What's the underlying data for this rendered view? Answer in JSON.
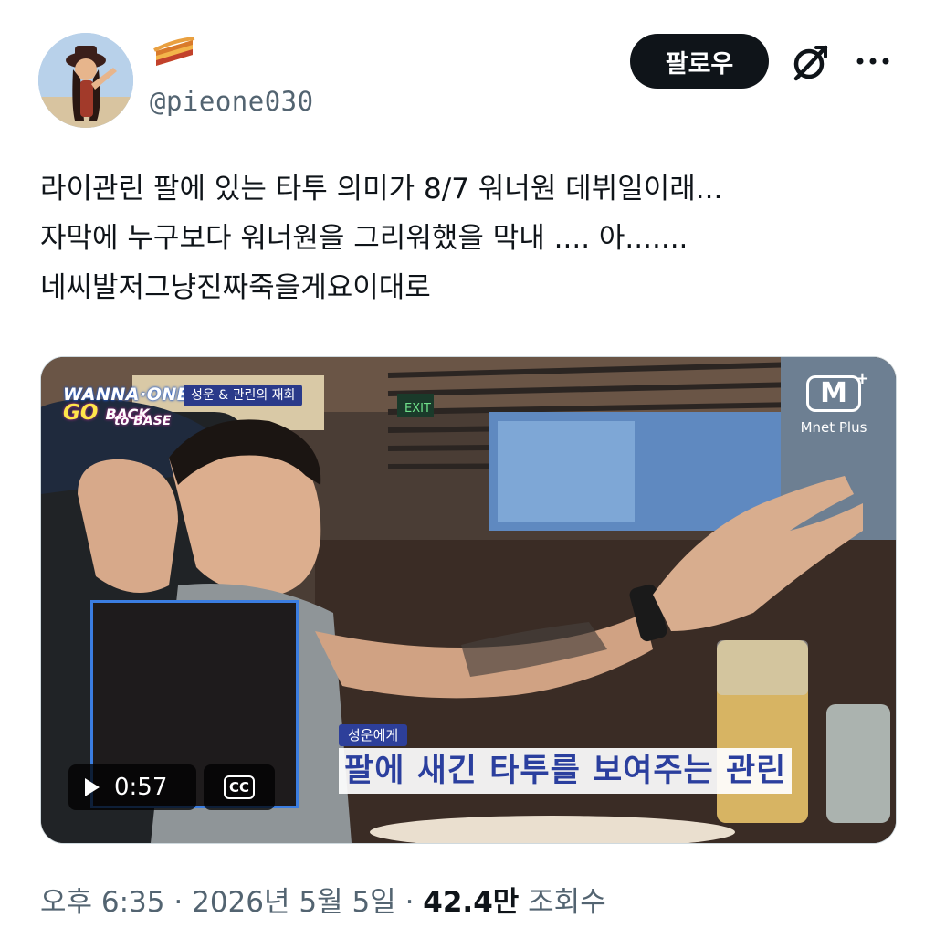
{
  "author": {
    "display_emoji": "pie-emoji",
    "handle": "@pieone030"
  },
  "header": {
    "follow_label": "팔로우",
    "grok_icon": "grok-icon",
    "more_icon": "more-icon"
  },
  "tweet": {
    "lines": [
      "라이관린 팔에 있는 타투 의미가 8/7 워너원 데뷔일이래...",
      "자막에 누구보다 워너원을 그리워했을 막내 .... 아.......",
      "네씨발저그냥진짜죽을게요이대로"
    ]
  },
  "media": {
    "show_badge": [
      "WANNA·ONE",
      "GO",
      "BACK",
      "to BASE"
    ],
    "episode_tag": "성운 & 관린의 재회",
    "channel_logo": "M",
    "channel_name": "Mnet Plus",
    "subtitle_small": "성운에게",
    "subtitle_main": "팔에 새긴 타투를 보여주는 관린",
    "exit_sign": "EXIT",
    "player": {
      "time": "0:57",
      "cc_label": "CC",
      "play_icon": "play-icon",
      "cc_icon": "closed-captions-icon"
    }
  },
  "meta": {
    "time": "오후 6:35",
    "separator": "·",
    "date": "2026년 5월 5일",
    "views_count": "42.4만",
    "views_label": "조회수"
  }
}
